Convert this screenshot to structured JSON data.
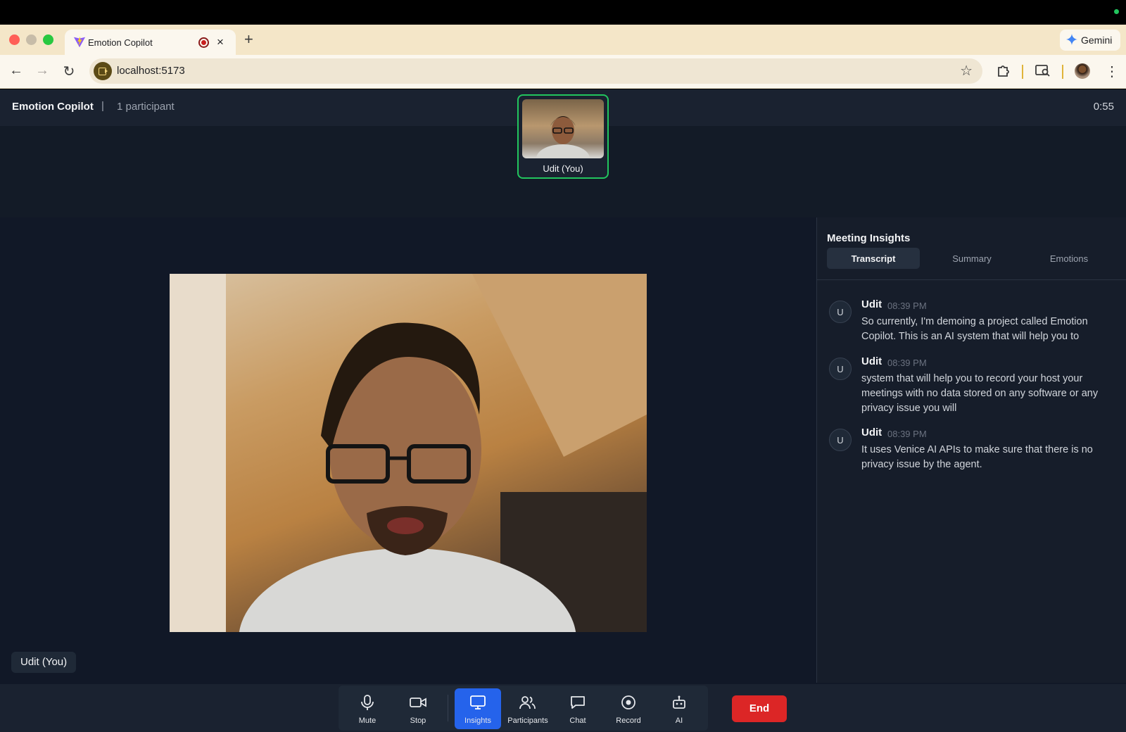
{
  "browser": {
    "tab_title": "Emotion Copilot",
    "tab_close": "×",
    "new_tab": "+",
    "gemini_label": "Gemini",
    "url": "localhost:5173"
  },
  "app": {
    "title": "Emotion Copilot",
    "divider": "|",
    "participants_count": "1 participant",
    "timer": "0:55"
  },
  "thumbnail": {
    "name": "Udit (You)"
  },
  "stage": {
    "name_label": "Udit (You)"
  },
  "insights": {
    "title": "Meeting Insights",
    "tabs": [
      "Transcript",
      "Summary",
      "Emotions"
    ],
    "active_tab": "Transcript",
    "messages": [
      {
        "initial": "U",
        "name": "Udit",
        "time": "08:39 PM",
        "text": "So currently, I'm demoing a project called Emotion Copilot. This is an AI system that will help you to"
      },
      {
        "initial": "U",
        "name": "Udit",
        "time": "08:39 PM",
        "text": "system that will help you to record your host your meetings with no data stored on any software or any privacy issue you will"
      },
      {
        "initial": "U",
        "name": "Udit",
        "time": "08:39 PM",
        "text": "It uses Venice AI APIs to make sure that there is no privacy issue by the agent."
      }
    ]
  },
  "controls": {
    "items": [
      {
        "label": "Mute",
        "icon": "microphone-icon"
      },
      {
        "label": "Stop",
        "icon": "video-camera-icon"
      },
      {
        "label": "Insights",
        "icon": "monitor-icon"
      },
      {
        "label": "Participants",
        "icon": "people-icon"
      },
      {
        "label": "Chat",
        "icon": "chat-bubble-icon"
      },
      {
        "label": "Record",
        "icon": "record-icon"
      },
      {
        "label": "AI",
        "icon": "robot-icon"
      }
    ],
    "active": "Insights",
    "end_label": "End"
  },
  "colors": {
    "accent": "#2563eb",
    "end": "#dc2626",
    "speaking_border": "#22c55e",
    "app_bg": "#111827"
  }
}
